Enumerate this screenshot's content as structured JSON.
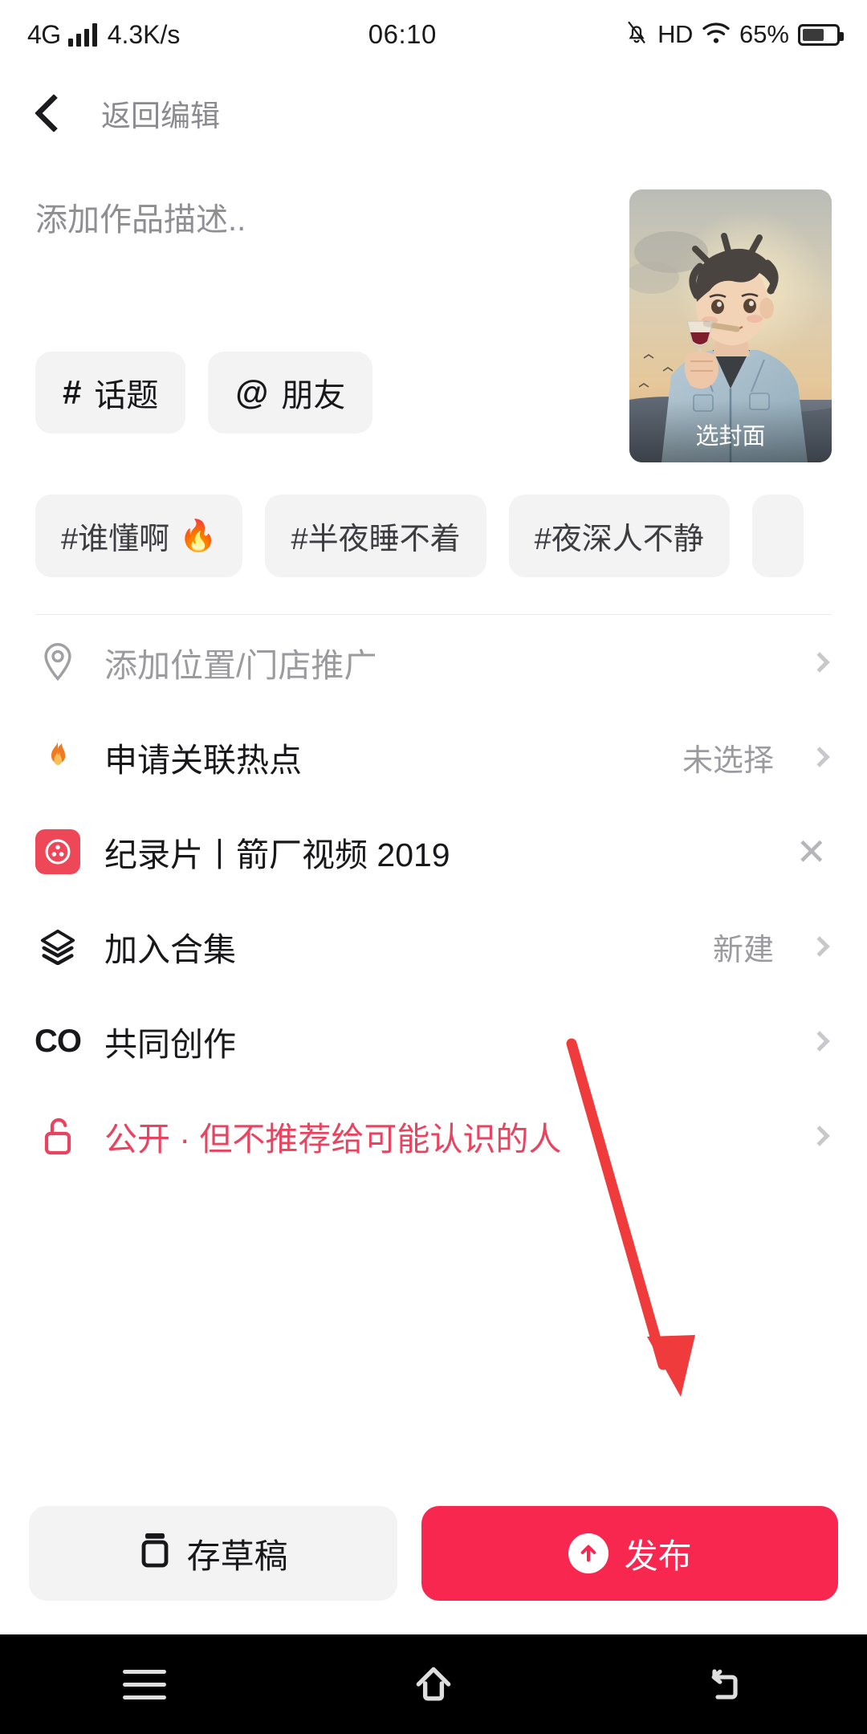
{
  "statusbar": {
    "network_type": "4G",
    "speed": "4.3K/s",
    "time": "06:10",
    "hd": "HD",
    "battery_percent": "65%",
    "icons": [
      "signal-bars-icon",
      "mute-bell-icon",
      "hd-icon",
      "wifi-icon",
      "battery-icon"
    ]
  },
  "navbar": {
    "back_label": "返回编辑",
    "back_icon": "chevron-left-icon"
  },
  "description": {
    "placeholder": "添加作品描述..",
    "value": ""
  },
  "cover": {
    "label": "选封面"
  },
  "insert_chips": [
    {
      "symbol": "#",
      "label": "话题",
      "name": "topic-chip"
    },
    {
      "symbol": "@",
      "label": "朋友",
      "name": "friend-chip"
    }
  ],
  "hashtag_suggestions": [
    {
      "label": "#谁懂啊",
      "emoji": "🔥"
    },
    {
      "label": "#半夜睡不着",
      "emoji": ""
    },
    {
      "label": "#夜深人不静",
      "emoji": ""
    },
    {
      "label": "",
      "emoji": ""
    }
  ],
  "rows": [
    {
      "icon": "location-pin-icon",
      "label": "添加位置/门店推广",
      "value": "",
      "trailing": "chevron-right-icon",
      "style": "muted"
    },
    {
      "icon": "flame-icon",
      "label": "申请关联热点",
      "value": "未选择",
      "trailing": "chevron-right-icon",
      "style": "normal"
    },
    {
      "icon": "film-reel-icon",
      "label": "纪录片丨箭厂视频 2019",
      "value": "",
      "trailing": "close-x-icon",
      "style": "normal"
    },
    {
      "icon": "layers-icon",
      "label": "加入合集",
      "value": "新建",
      "trailing": "chevron-right-icon",
      "style": "normal"
    },
    {
      "icon": "co-create-icon",
      "label": "共同创作",
      "value": "",
      "trailing": "chevron-right-icon",
      "style": "normal"
    },
    {
      "icon": "unlock-icon",
      "label": "公开 · 但不推荐给可能认识的人",
      "value": "",
      "trailing": "chevron-right-icon",
      "style": "accent"
    }
  ],
  "footer": {
    "draft_label": "存草稿",
    "draft_icon": "save-draft-icon",
    "publish_label": "发布",
    "publish_icon": "arrow-up-circle-icon"
  },
  "android_nav": {
    "menu_icon": "menu-icon",
    "home_icon": "home-icon",
    "back_icon": "back-icon"
  },
  "colors": {
    "accent_red": "#f8274f",
    "privacy_red": "#e8435f",
    "chip_bg": "#f3f3f4",
    "muted_text": "#9b9b9f",
    "annotation_arrow": "#ef3b3b"
  }
}
